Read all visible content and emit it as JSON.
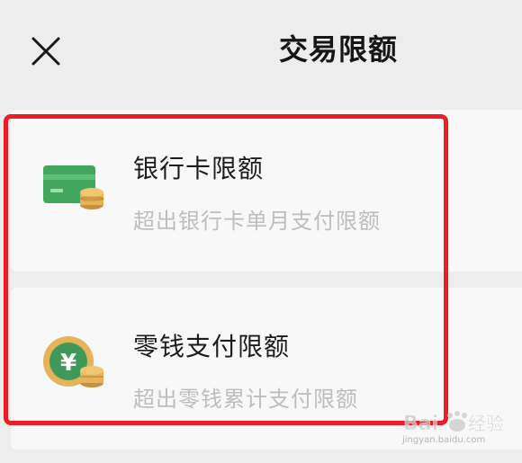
{
  "header": {
    "title": "交易限额",
    "close_icon": "close-icon"
  },
  "cards": [
    {
      "title": "银行卡限额",
      "subtitle": "超出银行卡单月支付限额",
      "icon": "bank-card-coins-icon"
    },
    {
      "title": "零钱支付限额",
      "subtitle": "超出零钱累计支付限额",
      "icon": "wallet-yuan-coins-icon"
    }
  ],
  "watermark": {
    "text": "Bai 经验",
    "sub": "jingyan.baidu.com"
  },
  "colors": {
    "background": "#ededed",
    "card": "#f8f8f8",
    "highlight": "#ee1c24",
    "bank_green": "#43a65d",
    "coin_gold": "#e5b35a",
    "wallet_green": "#3f9a5a"
  }
}
